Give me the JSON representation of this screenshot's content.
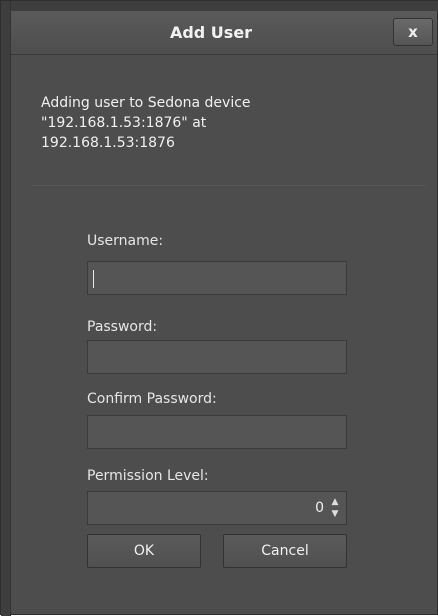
{
  "dialog": {
    "title": "Add User",
    "close_label": "x"
  },
  "info": {
    "line1": "Adding user to Sedona device",
    "line2": "\"192.168.1.53:1876\" at",
    "line3": "192.168.1.53:1876"
  },
  "form": {
    "username_label": "Username:",
    "username_value": "",
    "password_label": "Password:",
    "password_value": "",
    "confirm_label": "Confirm Password:",
    "confirm_value": "",
    "permission_label": "Permission Level:",
    "permission_value": "0"
  },
  "buttons": {
    "ok_label": "OK",
    "cancel_label": "Cancel"
  },
  "icons": {
    "spin_up": "chevron-up-icon",
    "spin_down": "chevron-down-icon"
  }
}
